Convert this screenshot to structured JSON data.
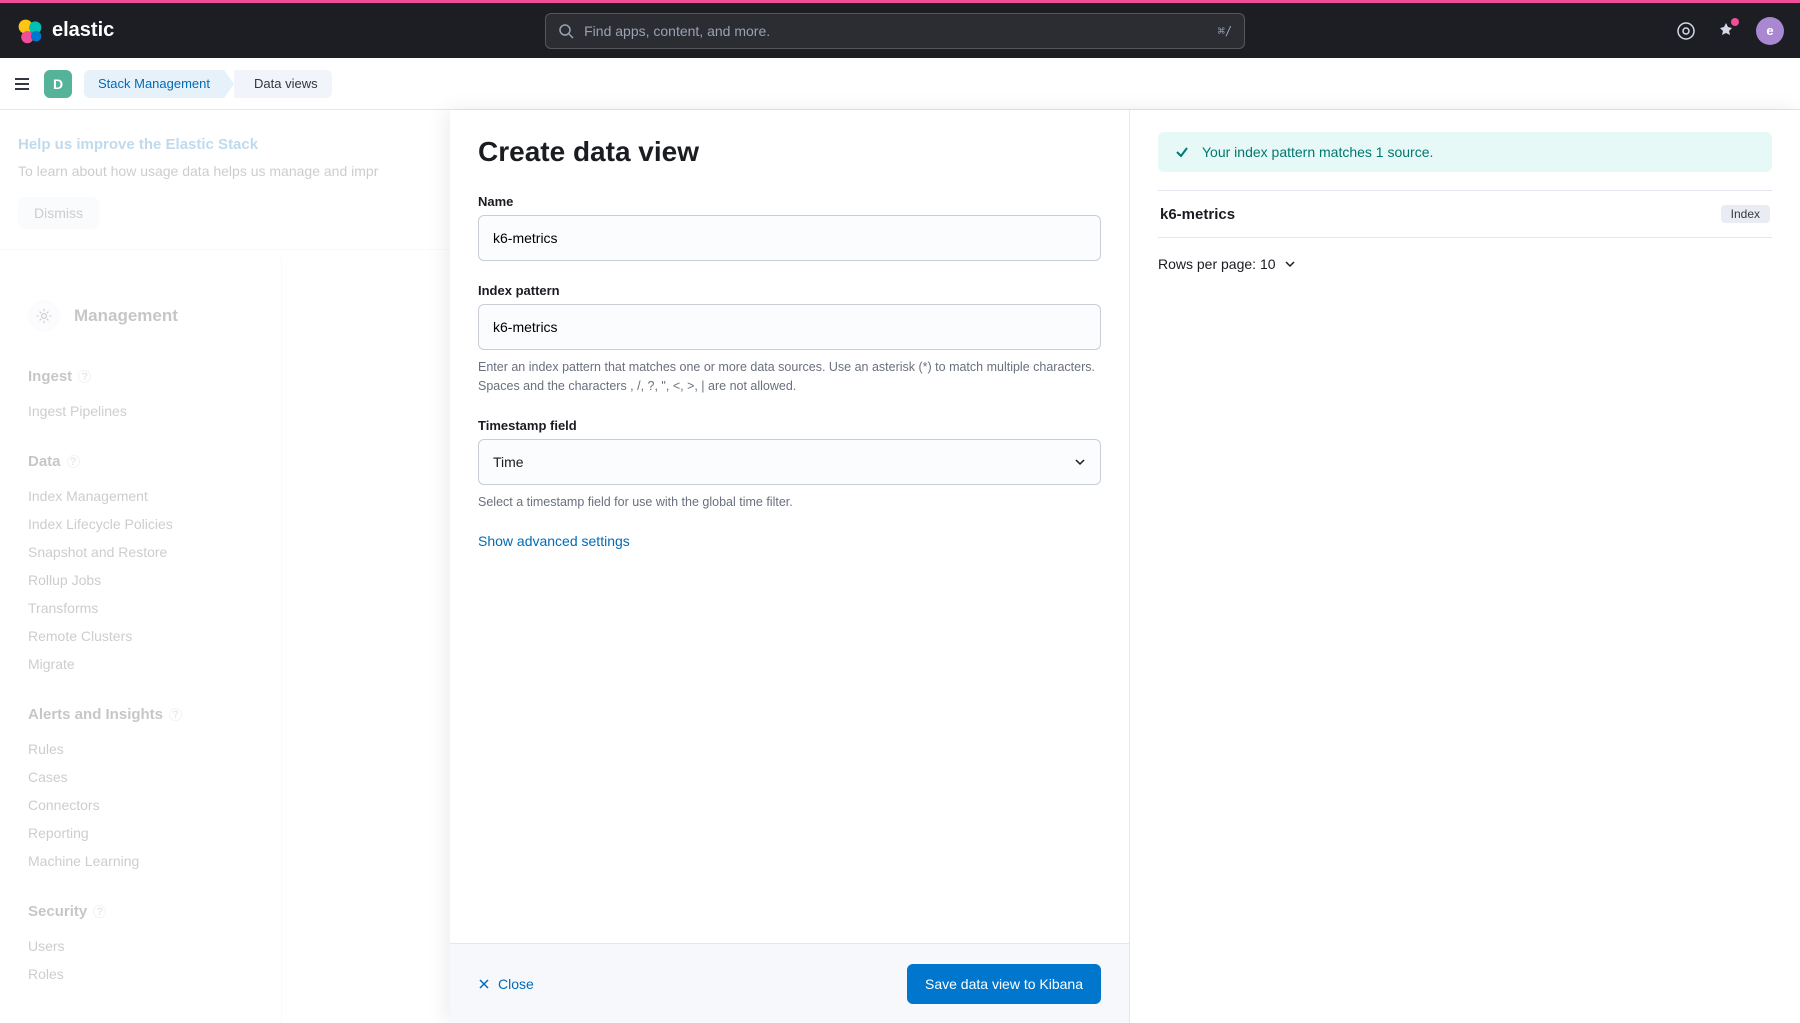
{
  "brand": "elastic",
  "search": {
    "placeholder": "Find apps, content, and more.",
    "shortcut": "⌘/"
  },
  "header_avatar_letter": "e",
  "space_letter": "D",
  "breadcrumb": {
    "root": "Stack Management",
    "current": "Data views"
  },
  "notice": {
    "title": "Help us improve the Elastic Stack",
    "text": "To learn about how usage data helps us manage and impr",
    "dismiss": "Dismiss"
  },
  "sidebar": {
    "title": "Management",
    "groups": [
      {
        "title": "Ingest",
        "help": true,
        "items": [
          "Ingest Pipelines"
        ]
      },
      {
        "title": "Data",
        "help": true,
        "items": [
          "Index Management",
          "Index Lifecycle Policies",
          "Snapshot and Restore",
          "Rollup Jobs",
          "Transforms",
          "Remote Clusters",
          "Migrate"
        ]
      },
      {
        "title": "Alerts and Insights",
        "help": true,
        "items": [
          "Rules",
          "Cases",
          "Connectors",
          "Reporting",
          "Machine Learning"
        ]
      },
      {
        "title": "Security",
        "help": true,
        "items": [
          "Users",
          "Roles"
        ]
      }
    ]
  },
  "flyout": {
    "title": "Create data view",
    "name_label": "Name",
    "name_value": "k6-metrics",
    "pattern_label": "Index pattern",
    "pattern_value": "k6-metrics",
    "pattern_help": "Enter an index pattern that matches one or more data sources. Use an asterisk (*) to match multiple characters. Spaces and the characters , /, ?, \", <, >, | are not allowed.",
    "timestamp_label": "Timestamp field",
    "timestamp_value": "Time",
    "timestamp_help": "Select a timestamp field for use with the global time filter.",
    "advanced": "Show advanced settings",
    "close": "Close",
    "save": "Save data view to Kibana"
  },
  "matches": {
    "callout": "Your index pattern matches 1 source.",
    "items": [
      {
        "name": "k6-metrics",
        "tag": "Index"
      }
    ],
    "rows_per_page": "Rows per page: 10"
  }
}
